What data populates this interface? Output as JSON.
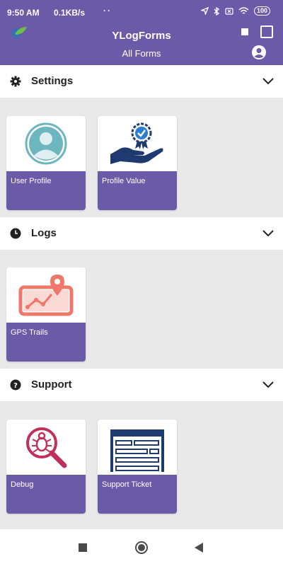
{
  "status_bar": {
    "time": "9:50 AM",
    "network_speed": "0.1KB/s",
    "extra": "··",
    "battery": "100"
  },
  "app_bar": {
    "title": "YLogForms",
    "subtitle": "All Forms"
  },
  "sections": [
    {
      "title": "Settings",
      "icon": "gear-icon",
      "cards": [
        {
          "label": "User Profile",
          "icon": "user-profile-icon"
        },
        {
          "label": "Profile Value",
          "icon": "award-hand-icon"
        }
      ]
    },
    {
      "title": "Logs",
      "icon": "clock-icon",
      "cards": [
        {
          "label": "GPS Trails",
          "icon": "gps-trail-icon"
        }
      ]
    },
    {
      "title": "Support",
      "icon": "help-icon",
      "cards": [
        {
          "label": "Debug",
          "icon": "bug-search-icon"
        },
        {
          "label": "Support Ticket",
          "icon": "ticket-form-icon"
        }
      ]
    }
  ],
  "colors": {
    "primary": "#6a5aa8",
    "background": "#e9e9e9",
    "card_icon_teal": "#6cb6c0",
    "card_icon_navy": "#1e3a6e",
    "card_icon_coral": "#f0786a",
    "card_icon_magenta": "#c0305a"
  }
}
